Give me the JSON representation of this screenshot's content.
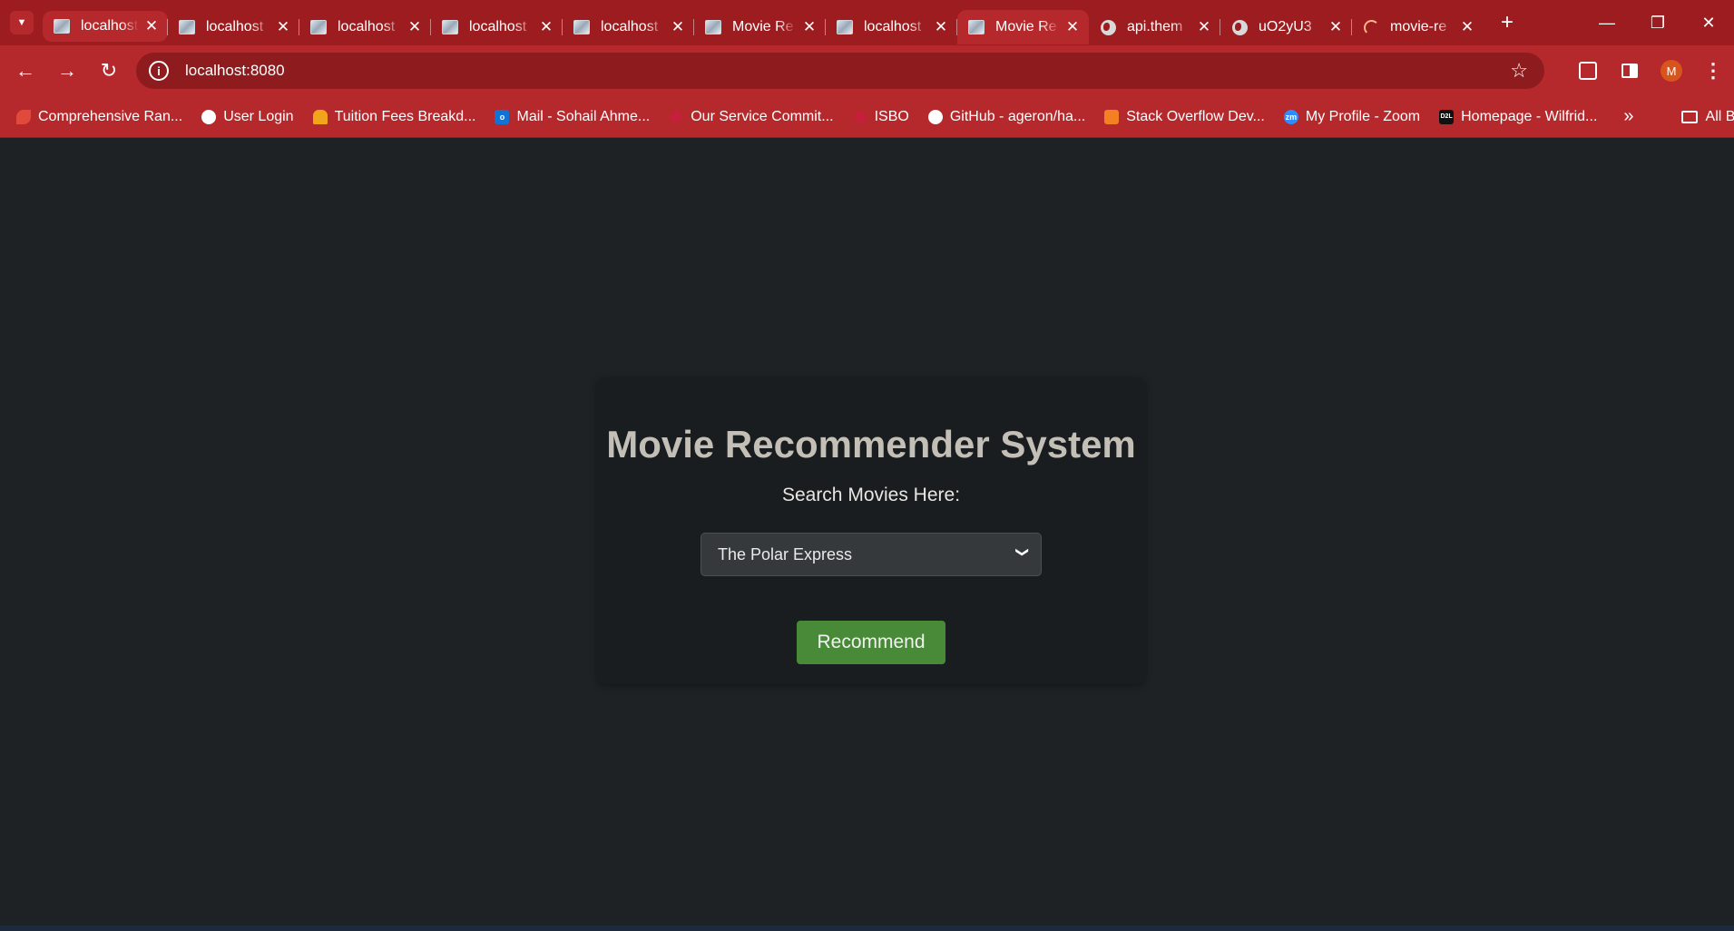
{
  "browser": {
    "tabs": [
      {
        "title": "localhost",
        "favicon": "page-image-icon",
        "active": false,
        "highlight": true
      },
      {
        "title": "localhost",
        "favicon": "page-image-icon",
        "active": false
      },
      {
        "title": "localhost",
        "favicon": "page-image-icon",
        "active": false
      },
      {
        "title": "localhost",
        "favicon": "page-image-icon",
        "active": false
      },
      {
        "title": "localhost",
        "favicon": "page-image-icon",
        "active": false
      },
      {
        "title": "Movie Re",
        "favicon": "page-image-icon",
        "active": false
      },
      {
        "title": "localhost",
        "favicon": "page-image-icon",
        "active": false
      },
      {
        "title": "Movie Re",
        "favicon": "page-image-icon",
        "active": true
      },
      {
        "title": "api.them",
        "favicon": "globe-icon",
        "active": false
      },
      {
        "title": "uO2yU3",
        "favicon": "globe-icon",
        "active": false
      },
      {
        "title": "movie-re",
        "favicon": "loading-spinner-icon",
        "active": false
      }
    ],
    "address": "localhost:8080",
    "profile_initial": "M",
    "bookmarks": [
      {
        "label": "Comprehensive Ran...",
        "icon": "red-leaf-icon",
        "color": "#e04a3a"
      },
      {
        "label": "User Login",
        "icon": "globe-icon",
        "color": "#ffffff"
      },
      {
        "label": "Tuition Fees Breakd...",
        "icon": "maple-leaf-icon",
        "color": "#f2a51a"
      },
      {
        "label": "Mail - Sohail Ahme...",
        "icon": "outlook-icon",
        "color": "#1273d4"
      },
      {
        "label": "Our Service Commit...",
        "icon": "red-diamond-icon",
        "color": "#c4203a"
      },
      {
        "label": "ISBO",
        "icon": "red-diamond-icon",
        "color": "#c4203a"
      },
      {
        "label": "GitHub - ageron/ha...",
        "icon": "github-icon",
        "color": "#ffffff"
      },
      {
        "label": "Stack Overflow Dev...",
        "icon": "stackoverflow-icon",
        "color": "#f48024"
      },
      {
        "label": "My Profile - Zoom",
        "icon": "zoom-icon",
        "color": "#2d8cff"
      },
      {
        "label": "Homepage - Wilfrid...",
        "icon": "d2l-icon",
        "color": "#111111"
      }
    ],
    "all_bookmarks_label": "All Bookmarks"
  },
  "page": {
    "title": "Movie Recommender System",
    "search_label": "Search Movies Here:",
    "selected_movie": "The Polar Express",
    "button_label": "Recommend"
  },
  "colors": {
    "browser_frame": "#9c1c1f",
    "toolbar": "#b5282b",
    "page_background": "#1e2224",
    "card_background": "#1a1d1f",
    "button": "#488a37"
  }
}
